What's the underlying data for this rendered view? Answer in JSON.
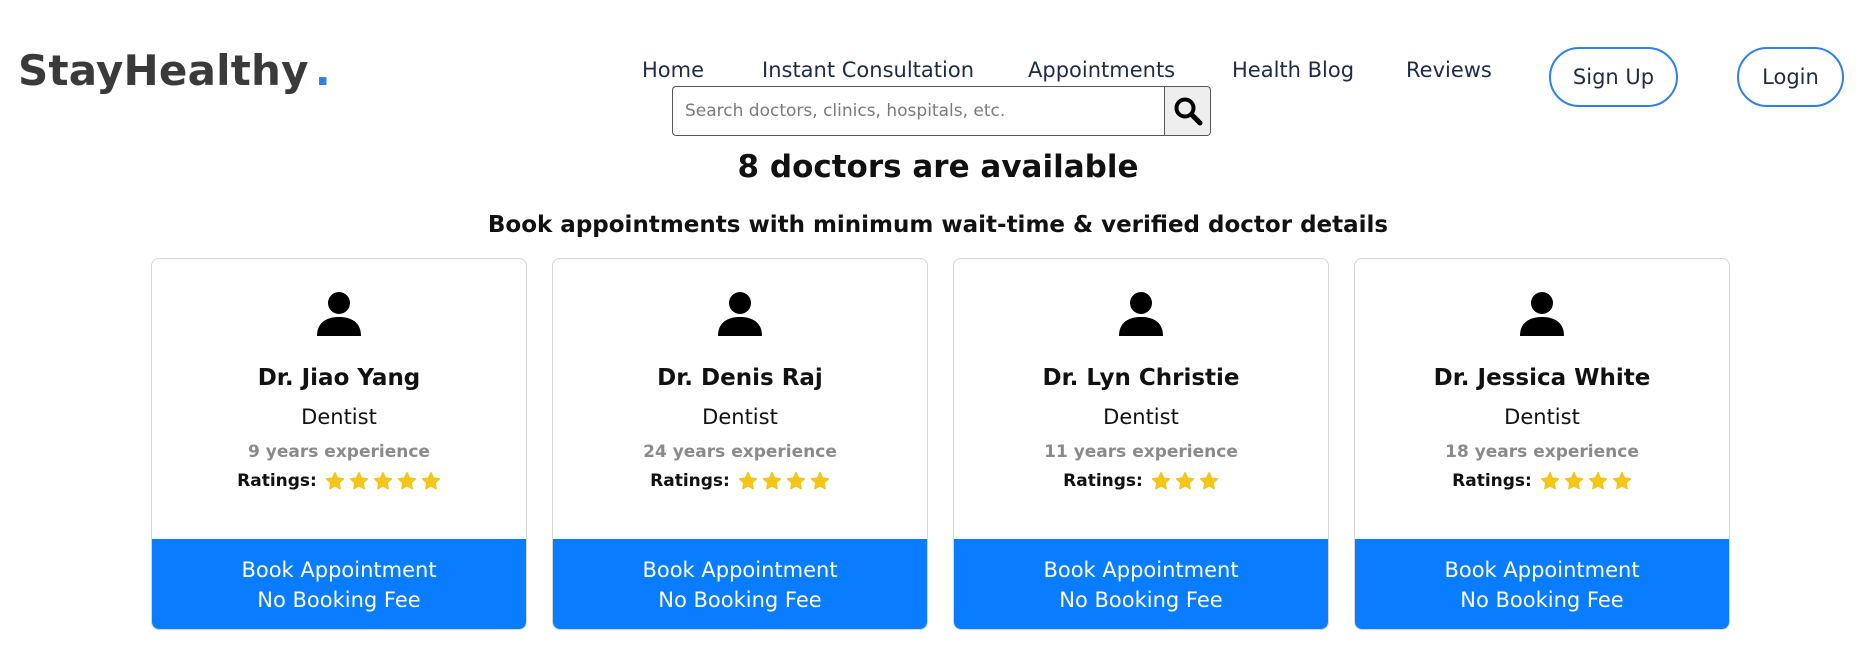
{
  "brand": {
    "name": "StayHealthy",
    "dot": ".",
    "dot_color": "#2f80ed"
  },
  "nav": {
    "items": [
      "Home",
      "Instant Consultation",
      "Appointments",
      "Health Blog",
      "Reviews"
    ],
    "signup_label": "Sign Up",
    "login_label": "Login"
  },
  "search": {
    "placeholder": "Search doctors, clinics, hospitals, etc.",
    "value": "",
    "icon": "search-icon"
  },
  "headline": "8 doctors are available",
  "subheadline": "Book appointments with minimum wait-time & verified doctor details",
  "colors": {
    "accent": "#0a7cff",
    "star": "#f5c518",
    "outline": "#2f80ed"
  },
  "doctors": [
    {
      "name": "Dr. Jiao Yang",
      "specialty": "Dentist",
      "experience": "9 years experience",
      "ratings_label": "Ratings:",
      "stars": 5,
      "book_label": "Book Appointment",
      "fee_label": "No Booking Fee"
    },
    {
      "name": "Dr. Denis Raj",
      "specialty": "Dentist",
      "experience": "24 years experience",
      "ratings_label": "Ratings:",
      "stars": 4,
      "book_label": "Book Appointment",
      "fee_label": "No Booking Fee"
    },
    {
      "name": "Dr. Lyn Christie",
      "specialty": "Dentist",
      "experience": "11 years experience",
      "ratings_label": "Ratings:",
      "stars": 3,
      "book_label": "Book Appointment",
      "fee_label": "No Booking Fee"
    },
    {
      "name": "Dr. Jessica White",
      "specialty": "Dentist",
      "experience": "18 years experience",
      "ratings_label": "Ratings:",
      "stars": 4,
      "book_label": "Book Appointment",
      "fee_label": "No Booking Fee"
    }
  ]
}
